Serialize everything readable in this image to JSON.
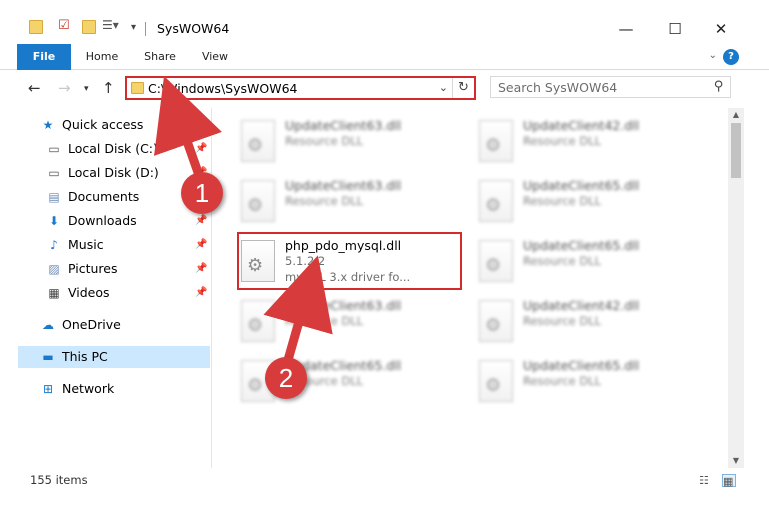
{
  "window": {
    "title": "SysWOW64",
    "minimize": "—",
    "maximize": "☐",
    "close": "✕"
  },
  "ribbon": {
    "tabs": [
      {
        "label": "File"
      },
      {
        "label": "Home"
      },
      {
        "label": "Share"
      },
      {
        "label": "View"
      }
    ],
    "help": "?"
  },
  "address": {
    "path": "C:\\Windows\\SysWOW64",
    "refresh": "↻"
  },
  "search": {
    "placeholder": "Search SysWOW64"
  },
  "sidebar": {
    "items": [
      {
        "label": "Quick access",
        "icon": "star-icon",
        "glyph": "★",
        "pinned": false
      },
      {
        "label": "Local Disk (C:)",
        "icon": "drive-icon",
        "glyph": "▭",
        "pinned": true
      },
      {
        "label": "Local Disk (D:)",
        "icon": "drive-icon",
        "glyph": "▭",
        "pinned": true
      },
      {
        "label": "Documents",
        "icon": "documents-icon",
        "glyph": "▤",
        "pinned": true
      },
      {
        "label": "Downloads",
        "icon": "download-icon",
        "glyph": "⬇",
        "pinned": true
      },
      {
        "label": "Music",
        "icon": "music-icon",
        "glyph": "♪",
        "pinned": true
      },
      {
        "label": "Pictures",
        "icon": "pictures-icon",
        "glyph": "▨",
        "pinned": true
      },
      {
        "label": "Videos",
        "icon": "video-icon",
        "glyph": "▦",
        "pinned": true
      },
      {
        "label": "OneDrive",
        "icon": "cloud-icon",
        "glyph": "☁",
        "pinned": false
      },
      {
        "label": "This PC",
        "icon": "computer-icon",
        "glyph": "▬",
        "pinned": false
      },
      {
        "label": "Network",
        "icon": "network-icon",
        "glyph": "⊞",
        "pinned": false
      }
    ]
  },
  "files": [
    {
      "name": "UpdateClient63.dll",
      "type": "Resource DLL"
    },
    {
      "name": "UpdateClient42.dll",
      "type": "Resource DLL"
    },
    {
      "name": "UpdateClient63.dll",
      "type": "Resource DLL"
    },
    {
      "name": "UpdateClient65.dll",
      "type": "Resource DLL"
    },
    {
      "name": "php_pdo_mysql.dll",
      "version": "5.1.2.2",
      "description": "mySQL 3.x driver fo..."
    },
    {
      "name": "UpdateClient65.dll",
      "type": "Resource DLL"
    },
    {
      "name": "UpdateClient63.dll",
      "type": "Resource DLL"
    },
    {
      "name": "UpdateClient42.dll",
      "type": "Resource DLL"
    },
    {
      "name": "UpdateClient65.dll",
      "type": "Resource DLL"
    },
    {
      "name": "UpdateClient65.dll",
      "type": "Resource DLL"
    }
  ],
  "status": {
    "item_count": "155 items"
  },
  "callouts": {
    "step1": "1",
    "step2": "2"
  },
  "colors": {
    "accent": "#1979ca",
    "callout": "#d83b3b",
    "selection": "#cce8ff"
  }
}
